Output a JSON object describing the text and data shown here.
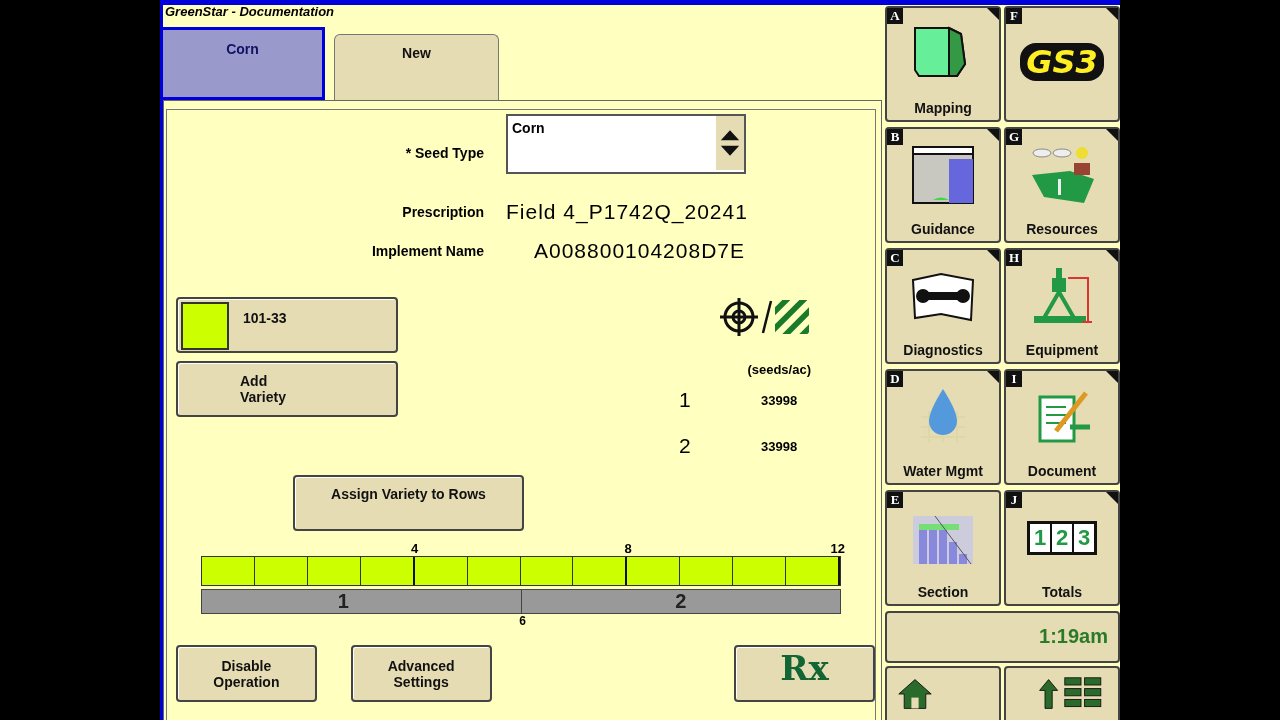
{
  "window": {
    "title": "GreenStar - Documentation"
  },
  "tabs": [
    {
      "label": "Corn",
      "selected": true
    },
    {
      "label": "New",
      "selected": false
    }
  ],
  "form": [
    {
      "kind": "dropdown",
      "label": "* Seed Type",
      "value": "Corn"
    },
    {
      "kind": "text",
      "label": "Prescription",
      "value": "Field 4_P1742Q_20241"
    },
    {
      "kind": "text",
      "label": "Implement Name",
      "value": "A008800104208D7E"
    }
  ],
  "varieties": [
    {
      "label": "101-33",
      "color": "#ccff00"
    }
  ],
  "add_variety": "Add\nVariety",
  "rates": {
    "unit": "(seeds/ac)",
    "rows": [
      {
        "section": "1",
        "value": "33998"
      },
      {
        "section": "2",
        "value": "33998"
      }
    ]
  },
  "assign_button": "Assign Variety to Rows",
  "rows": [
    {
      "color": "#ccff00"
    },
    {
      "color": "#ccff00"
    },
    {
      "color": "#ccff00"
    },
    {
      "color": "#ccff00",
      "tick": "4"
    },
    {
      "color": "#ccff00"
    },
    {
      "color": "#ccff00"
    },
    {
      "color": "#ccff00"
    },
    {
      "color": "#ccff00",
      "tick": "8"
    },
    {
      "color": "#ccff00"
    },
    {
      "color": "#ccff00"
    },
    {
      "color": "#ccff00"
    },
    {
      "color": "#ccff00",
      "tick": "12"
    }
  ],
  "sections": [
    {
      "label": "1",
      "end_label": "6"
    },
    {
      "label": "2"
    }
  ],
  "bottom_buttons": [
    {
      "kind": "text",
      "label": "Disable\nOperation"
    },
    {
      "kind": "text",
      "label": "Advanced\nSettings"
    },
    {
      "kind": "spacer"
    },
    {
      "kind": "rx",
      "label": "Rx"
    }
  ],
  "softkeys": [
    {
      "letter": "A",
      "kind": "mapping",
      "label": "Mapping",
      "menu": true
    },
    {
      "letter": "F",
      "kind": "logo",
      "label": "GS3",
      "menu": true
    },
    {
      "letter": "B",
      "kind": "guidance",
      "label": "Guidance",
      "menu": true
    },
    {
      "letter": "G",
      "kind": "resources",
      "label": "Resources",
      "menu": true
    },
    {
      "letter": "C",
      "kind": "diagnostics",
      "label": "Diagnostics",
      "menu": true
    },
    {
      "letter": "H",
      "kind": "equipment",
      "label": "Equipment",
      "menu": true
    },
    {
      "letter": "D",
      "kind": "water",
      "label": "Water Mgmt",
      "menu": true
    },
    {
      "letter": "I",
      "kind": "document",
      "label": "Document",
      "menu": true
    },
    {
      "letter": "E",
      "kind": "section",
      "label": "Section",
      "menu": false
    },
    {
      "letter": "J",
      "kind": "totals",
      "label": "Totals",
      "menu": true,
      "digits": [
        "1",
        "2",
        "3"
      ]
    }
  ],
  "clock": "1:19am",
  "nav_keys": [
    {
      "kind": "home"
    },
    {
      "kind": "layout"
    }
  ]
}
